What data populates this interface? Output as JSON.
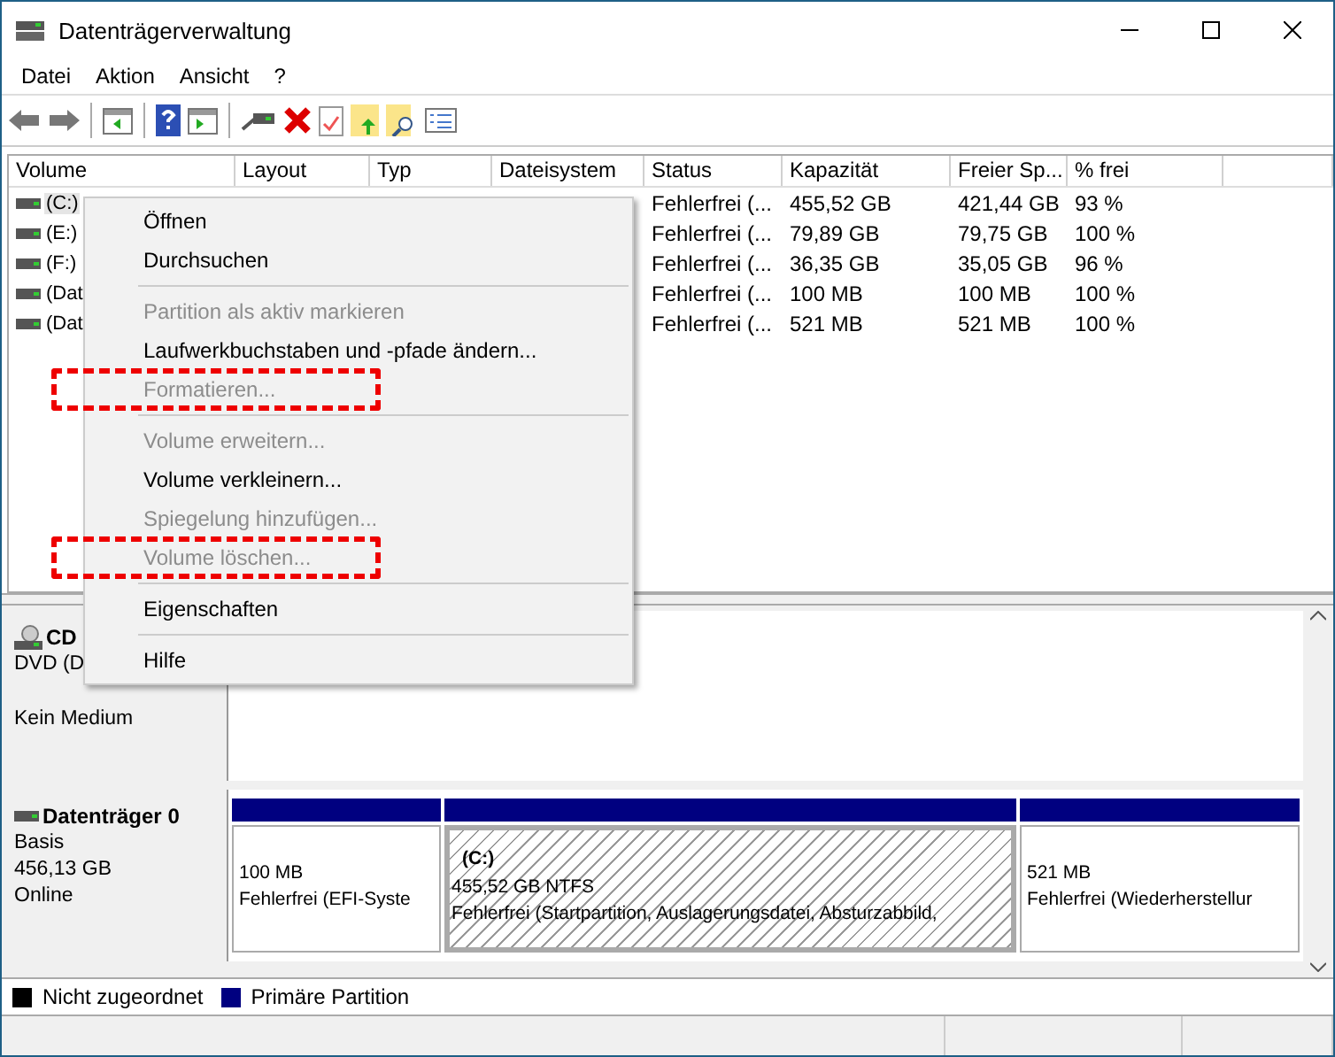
{
  "window": {
    "title": "Datenträgerverwaltung"
  },
  "menu": [
    "Datei",
    "Aktion",
    "Ansicht",
    "?"
  ],
  "table": {
    "columns": [
      "Volume",
      "Layout",
      "Typ",
      "Dateisystem",
      "Status",
      "Kapazität",
      "Freier Sp...",
      "% frei"
    ],
    "rows": [
      {
        "volume": "(C:)",
        "status": "Fehlerfrei (...",
        "capacity": "455,52 GB",
        "free": "421,44 GB",
        "pct": "93 %",
        "selected": true
      },
      {
        "volume": "(E:)",
        "status": "Fehlerfrei (...",
        "capacity": "79,89 GB",
        "free": "79,75 GB",
        "pct": "100 %",
        "selected": false
      },
      {
        "volume": "(F:)",
        "status": "Fehlerfrei (...",
        "capacity": "36,35 GB",
        "free": "35,05 GB",
        "pct": "96 %",
        "selected": false
      },
      {
        "volume": "(Dat",
        "status": "Fehlerfrei (...",
        "capacity": "100 MB",
        "free": "100 MB",
        "pct": "100 %",
        "selected": false
      },
      {
        "volume": "(Dat",
        "status": "Fehlerfrei (...",
        "capacity": "521 MB",
        "free": "521 MB",
        "pct": "100 %",
        "selected": false
      }
    ]
  },
  "context_menu": [
    {
      "kind": "item",
      "label": "Öffnen",
      "disabled": false,
      "marked": false
    },
    {
      "kind": "item",
      "label": "Durchsuchen",
      "disabled": false,
      "marked": false
    },
    {
      "kind": "separator"
    },
    {
      "kind": "item",
      "label": "Partition als aktiv markieren",
      "disabled": true,
      "marked": false
    },
    {
      "kind": "item",
      "label": "Laufwerkbuchstaben und -pfade ändern...",
      "disabled": false,
      "marked": false
    },
    {
      "kind": "item",
      "label": "Formatieren...",
      "disabled": true,
      "marked": true
    },
    {
      "kind": "separator"
    },
    {
      "kind": "item",
      "label": "Volume erweitern...",
      "disabled": true,
      "marked": false
    },
    {
      "kind": "item",
      "label": "Volume verkleinern...",
      "disabled": false,
      "marked": false
    },
    {
      "kind": "item",
      "label": "Spiegelung hinzufügen...",
      "disabled": true,
      "marked": false
    },
    {
      "kind": "item",
      "label": "Volume löschen...",
      "disabled": true,
      "marked": true
    },
    {
      "kind": "separator"
    },
    {
      "kind": "item",
      "label": "Eigenschaften",
      "disabled": false,
      "marked": false
    },
    {
      "kind": "separator"
    },
    {
      "kind": "item",
      "label": "Hilfe",
      "disabled": false,
      "marked": false
    }
  ],
  "disks": [
    {
      "kind": "cdrom",
      "name": "CD",
      "lines": [
        "DVD (D",
        "Kein Medium"
      ]
    },
    {
      "kind": "disk",
      "name": "Datenträger 0",
      "lines": [
        "Basis",
        "456,13 GB",
        "Online"
      ],
      "partitions": [
        {
          "size": "100 MB",
          "status": "Fehlerfrei (EFI-Syste",
          "selected": false
        },
        {
          "title": "(C:)",
          "size": "455,52 GB NTFS",
          "status": "Fehlerfrei (Startpartition, Auslagerungsdatei, Absturzabbild,",
          "selected": true
        },
        {
          "size": "521 MB",
          "status": "Fehlerfrei (Wiederherstellur",
          "selected": false
        }
      ]
    }
  ],
  "legend": [
    {
      "label": "Nicht zugeordnet",
      "color": "#000000"
    },
    {
      "label": "Primäre Partition",
      "color": "#000080"
    }
  ]
}
